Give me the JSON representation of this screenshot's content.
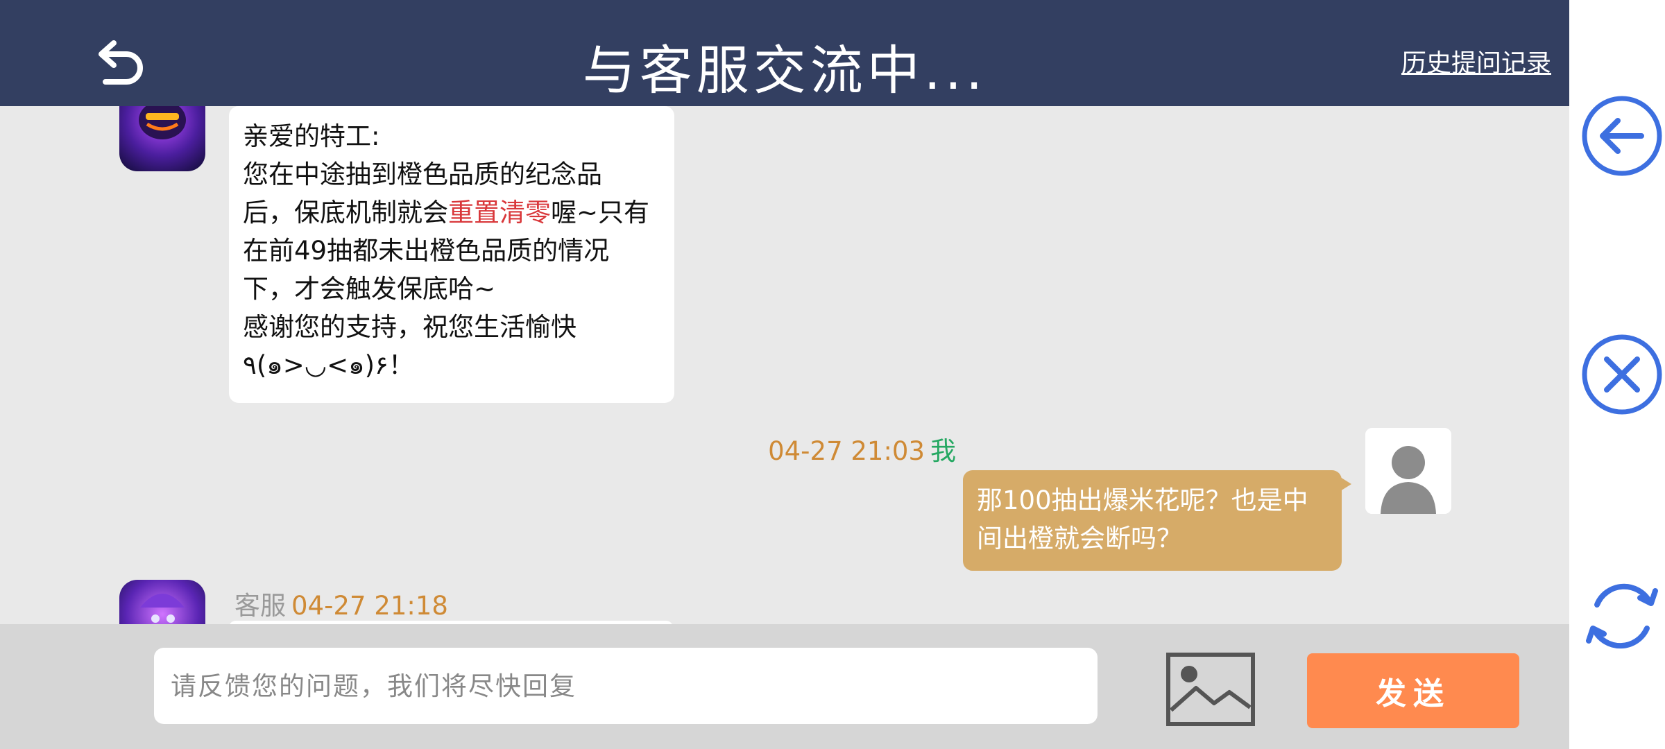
{
  "header": {
    "title": "与客服交流中...",
    "history_link": "历史提问记录"
  },
  "messages": {
    "agent_1": {
      "lines": [
        {
          "parts": [
            {
              "text": "亲爱的特工:"
            }
          ]
        },
        {
          "parts": [
            {
              "text": "您在中途抽到橙色品质的纪念品"
            }
          ]
        },
        {
          "parts": [
            {
              "text": "后，保底机制就会"
            },
            {
              "text": "重置清零",
              "highlight": true
            },
            {
              "text": "喔~只有"
            }
          ]
        },
        {
          "parts": [
            {
              "text": "在前49抽都未出橙色品质的情况"
            }
          ]
        },
        {
          "parts": [
            {
              "text": "下，才会触发保底哈~"
            }
          ]
        },
        {
          "parts": [
            {
              "text": "感谢您的支持，祝您生活愉快"
            }
          ]
        },
        {
          "parts": [
            {
              "text": "٩(๑>◡<๑)۶！"
            }
          ]
        }
      ]
    },
    "user_1": {
      "timestamp": "04-27 21:03",
      "sender": "我",
      "text": "那100抽出爆米花呢？也是中间出橙就会断吗？"
    },
    "agent_2": {
      "sender": "客服",
      "timestamp": "04-27 21:18"
    }
  },
  "input": {
    "placeholder": "请反馈您的问题，我们将尽快回复",
    "send_label": "发送"
  },
  "side_controls": [
    "back-arrow-icon",
    "close-icon",
    "refresh-icon"
  ],
  "colors": {
    "header_bg": "#333f61",
    "chat_bg": "#e9e9e9",
    "user_bubble": "#d6ab68",
    "send_button": "#ff8a4f",
    "side_icon": "#3d6fe0",
    "timestamp": "#cf8a35",
    "me_label": "#25a862",
    "highlight_red": "#d9373a"
  }
}
